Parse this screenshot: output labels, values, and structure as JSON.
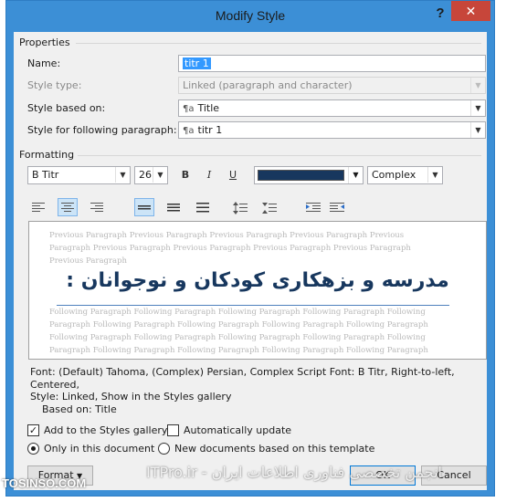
{
  "dialog": {
    "title": "Modify Style",
    "help_label": "?",
    "close_label": "✕"
  },
  "properties": {
    "section_label": "Properties",
    "name_label": "Name:",
    "name_value": "titr 1",
    "style_type_label": "Style type:",
    "style_type_value": "Linked (paragraph and character)",
    "based_on_label": "Style based on:",
    "based_on_value": "Title",
    "following_label": "Style for following paragraph:",
    "following_value": "titr 1",
    "para_mark": "¶a"
  },
  "formatting": {
    "section_label": "Formatting",
    "font_name": "B Titr",
    "font_size": "26",
    "bold_label": "B",
    "italic_label": "I",
    "underline_label": "U",
    "script_value": "Complex",
    "font_color": "#17375e"
  },
  "preview": {
    "previous_paragraph": "Previous Paragraph Previous Paragraph Previous Paragraph Previous Paragraph Previous Paragraph Previous Paragraph Previous Paragraph Previous Paragraph Previous Paragraph Previous Paragraph",
    "sample_text": "مدرسه و بزهکاری کودکان و نوجوانان :",
    "following_paragraph": "Following Paragraph Following Paragraph Following Paragraph Following Paragraph Following Paragraph Following Paragraph Following Paragraph Following Paragraph Following Paragraph Following Paragraph Following Paragraph Following Paragraph Following Paragraph Following Paragraph Following Paragraph Following Paragraph Following Paragraph Following Paragraph Following Paragraph Following Paragraph"
  },
  "description": {
    "line1": "Font: (Default) Tahoma, (Complex) Persian, Complex Script Font: B Titr, Right-to-left, Centered,",
    "line2": "Style: Linked, Show in the Styles gallery",
    "line3": "Based on: Title"
  },
  "options": {
    "add_to_gallery": "Add to the Styles gallery",
    "auto_update": "Automatically update",
    "only_this_doc": "Only in this document",
    "new_docs": "New documents based on this template"
  },
  "buttons": {
    "format": "Format",
    "ok": "OK",
    "cancel": "Cancel"
  },
  "watermark": {
    "left": "TOSINSO.COM",
    "center": "ITPro.ir - انجمن تخصصی فناوری اطلاعات ایران"
  }
}
